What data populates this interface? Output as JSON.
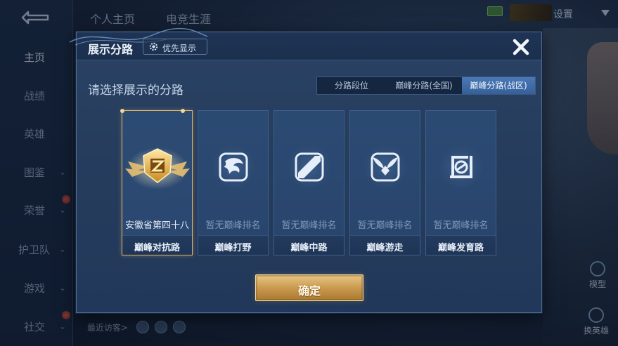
{
  "left_nav": {
    "items": [
      {
        "label": "主页",
        "active": true,
        "chevron": false
      },
      {
        "label": "战绩",
        "active": false,
        "chevron": false
      },
      {
        "label": "英雄",
        "active": false,
        "chevron": false
      },
      {
        "label": "图鉴",
        "active": false,
        "chevron": true
      },
      {
        "label": "荣誉",
        "active": false,
        "chevron": true
      },
      {
        "label": "护卫队",
        "active": false,
        "chevron": true
      },
      {
        "label": "游戏",
        "active": false,
        "chevron": true
      },
      {
        "label": "社交",
        "active": false,
        "chevron": true
      }
    ]
  },
  "top_tabs": [
    "个人主页",
    "电竞生涯"
  ],
  "top_right": {
    "settings_label": "设置"
  },
  "side_buttons": {
    "model": "模型",
    "switch_hero": "换英雄"
  },
  "recent_visitors_label": "最近访客>",
  "modal": {
    "title": "展示分路",
    "priority_label": "优先显示",
    "subtitle": "请选择展示的分路",
    "segments": [
      {
        "label": "分路段位",
        "active": false
      },
      {
        "label": "巅峰分路(全国)",
        "active": false
      },
      {
        "label": "巅峰分路(战区)",
        "active": true
      }
    ],
    "cards": [
      {
        "name": "巅峰对抗路",
        "rank_text": "安徽省第四十八",
        "selected": true,
        "icon": "gold-shield-emblem-icon"
      },
      {
        "name": "巅峰打野",
        "rank_text": "暂无巅峰排名",
        "selected": false,
        "icon": "dragon-jungle-icon"
      },
      {
        "name": "巅峰中路",
        "rank_text": "暂无巅峰排名",
        "selected": false,
        "icon": "mid-lane-slash-icon"
      },
      {
        "name": "巅峰游走",
        "rank_text": "暂无巅峰排名",
        "selected": false,
        "icon": "wings-support-icon"
      },
      {
        "name": "巅峰发育路",
        "rank_text": "暂无巅峰排名",
        "selected": false,
        "icon": "farm-lane-icon"
      }
    ],
    "confirm_label": "确定"
  },
  "colors": {
    "accent_gold": "#e0b46a",
    "active_tab": "#4b79b6",
    "modal_bg": "#263d5e"
  }
}
